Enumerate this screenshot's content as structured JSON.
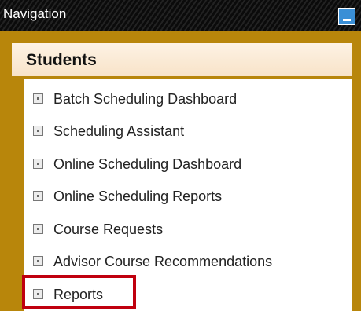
{
  "panel": {
    "title": "Navigation",
    "section_header": "Students",
    "items": [
      {
        "label": "Batch Scheduling Dashboard"
      },
      {
        "label": "Scheduling Assistant"
      },
      {
        "label": "Online Scheduling Dashboard"
      },
      {
        "label": "Online Scheduling Reports"
      },
      {
        "label": "Course Requests"
      },
      {
        "label": "Advisor Course Recommendations"
      },
      {
        "label": "Reports"
      }
    ],
    "collapse_icon": "minimize-icon",
    "item_icon": "square-bullet-icon",
    "highlighted_item": "Reports"
  },
  "colors": {
    "titlebar_bg": "#0e0e0e",
    "border_gold": "#b8860b",
    "header_bg": "#fbeedd",
    "highlight_red": "#c0000e",
    "collapse_blue": "#3a8fd6"
  }
}
